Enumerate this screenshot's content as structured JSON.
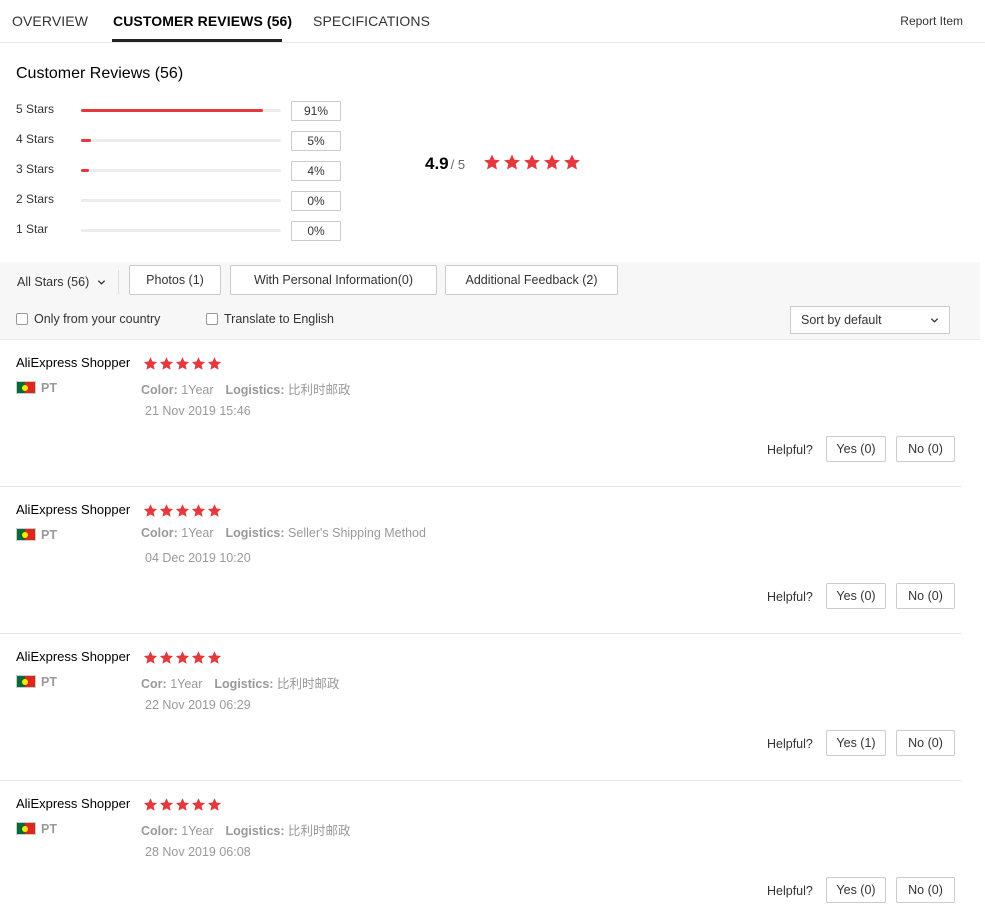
{
  "tabs": [
    {
      "label": "OVERVIEW"
    },
    {
      "label": "CUSTOMER REVIEWS (56)"
    },
    {
      "label": "SPECIFICATIONS"
    }
  ],
  "report_label": "Report Item",
  "summary": {
    "title": "Customer Reviews (56)",
    "rows": [
      {
        "label": "5 Stars",
        "pct": "91%",
        "fill": 0.91
      },
      {
        "label": "4 Stars",
        "pct": "5%",
        "fill": 0.05
      },
      {
        "label": "3 Stars",
        "pct": "4%",
        "fill": 0.04
      },
      {
        "label": "2 Stars",
        "pct": "0%",
        "fill": 0
      },
      {
        "label": "1 Star",
        "pct": "0%",
        "fill": 0
      }
    ],
    "average": "4.9",
    "out_of": "/ 5",
    "average_stars": 5
  },
  "filters": {
    "all_stars": "All Stars (56)",
    "photos": "Photos (1)",
    "personal": "With Personal Information(0)",
    "additional": "Additional Feedback (2)",
    "only_country": "Only from your country",
    "translate": "Translate to English",
    "sort": "Sort by default"
  },
  "helpful_label": "Helpful?",
  "reviews": [
    {
      "name": "AliExpress Shopper",
      "stars": 5,
      "country": "PT",
      "attr_label": "Color:",
      "attr_value": "1Year",
      "logistics_label": "Logistics:",
      "logistics_value": "比利时邮政",
      "date": "21 Nov 2019 15:46",
      "yes": "Yes (0)",
      "no": "No (0)"
    },
    {
      "name": "AliExpress Shopper",
      "stars": 5,
      "country": "PT",
      "attr_label": "Color:",
      "attr_value": "1Year",
      "logistics_label": "Logistics:",
      "logistics_value": "Seller's Shipping Method",
      "date": "04 Dec 2019 10:20",
      "yes": "Yes (0)",
      "no": "No (0)"
    },
    {
      "name": "AliExpress Shopper",
      "stars": 5,
      "country": "PT",
      "attr_label": "Cor:",
      "attr_value": "1Year",
      "logistics_label": "Logistics:",
      "logistics_value": "比利时邮政",
      "date": "22 Nov 2019 06:29",
      "yes": "Yes (1)",
      "no": "No (0)"
    },
    {
      "name": "AliExpress Shopper",
      "stars": 5,
      "country": "PT",
      "attr_label": "Color:",
      "attr_value": "1Year",
      "logistics_label": "Logistics:",
      "logistics_value": "比利时邮政",
      "date": "28 Nov 2019 06:08",
      "yes": "Yes (0)",
      "no": "No (0)"
    }
  ],
  "colors": {
    "accent": "#e4393c",
    "muted_text": "#999999",
    "border": "#cccccc"
  }
}
